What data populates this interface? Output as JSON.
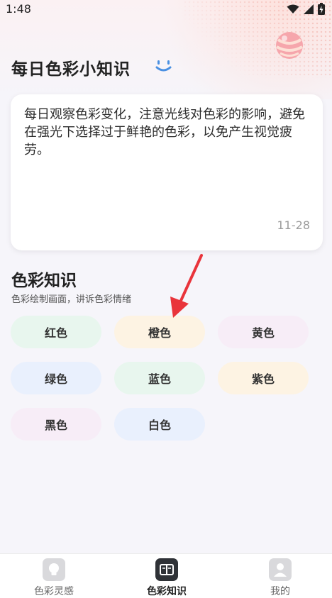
{
  "status_bar": {
    "time": "1:48"
  },
  "header": {
    "title": "每日色彩小知识"
  },
  "tip_card": {
    "text": "每日观察色彩变化，注意光线对色彩的影响，避免在强光下选择过于鲜艳的色彩，以免产生视觉疲劳。",
    "date": "11-28"
  },
  "section": {
    "title": "色彩知识",
    "subtitle": "色彩绘制画面，讲诉色彩情绪",
    "colors": [
      {
        "label": "红色",
        "bg": "#e8f6ee"
      },
      {
        "label": "橙色",
        "bg": "#fdf3e3"
      },
      {
        "label": "黄色",
        "bg": "#f7edf7"
      },
      {
        "label": "绿色",
        "bg": "#e9f0fd"
      },
      {
        "label": "蓝色",
        "bg": "#e8f6ee"
      },
      {
        "label": "紫色",
        "bg": "#fdf3e3"
      },
      {
        "label": "黑色",
        "bg": "#f7edf7"
      },
      {
        "label": "白色",
        "bg": "#e9f0fd"
      }
    ]
  },
  "bottom_nav": {
    "items": [
      {
        "label": "色彩灵感",
        "icon": "lightbulb-icon",
        "active": false
      },
      {
        "label": "色彩知识",
        "icon": "book-icon",
        "active": true
      },
      {
        "label": "我的",
        "icon": "person-icon",
        "active": false
      }
    ]
  },
  "colors": {
    "accent": "#4a90e2",
    "arrow": "#e9343b",
    "active_nav": "#2f3237"
  }
}
